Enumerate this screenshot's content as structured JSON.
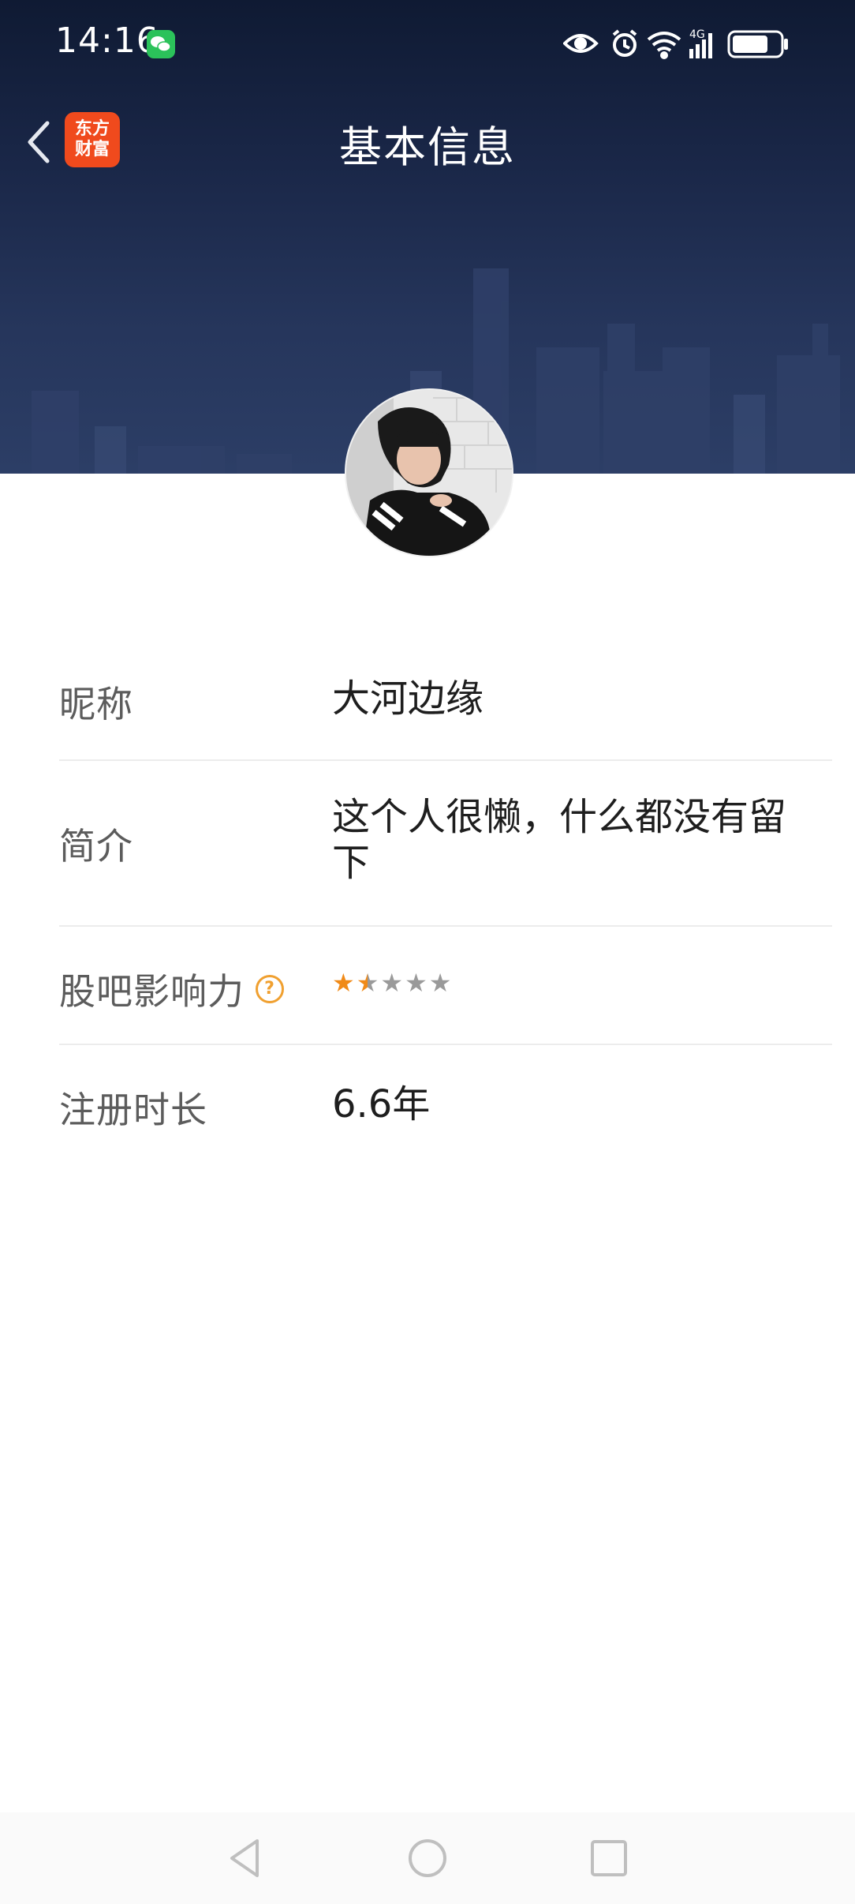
{
  "status_bar": {
    "time": "14:16",
    "icons": [
      "wechat-icon",
      "eye-icon",
      "alarm-icon",
      "wifi-icon",
      "signal-4g-icon",
      "battery-icon"
    ]
  },
  "nav": {
    "title": "基本信息",
    "app_logo_line1": "东方",
    "app_logo_line2": "财富"
  },
  "profile": {
    "rows": [
      {
        "label": "昵称",
        "value": "大河边缘"
      },
      {
        "label": "简介",
        "value": "这个人很懒，什么都没有留下"
      },
      {
        "label": "股吧影响力",
        "rating": 1.5,
        "max": 5
      },
      {
        "label": "注册时长",
        "value": "6.6年"
      }
    ]
  },
  "colors": {
    "banner": "#1a2748",
    "accent": "#f08a18",
    "logo_bg": "#f04a1d"
  }
}
